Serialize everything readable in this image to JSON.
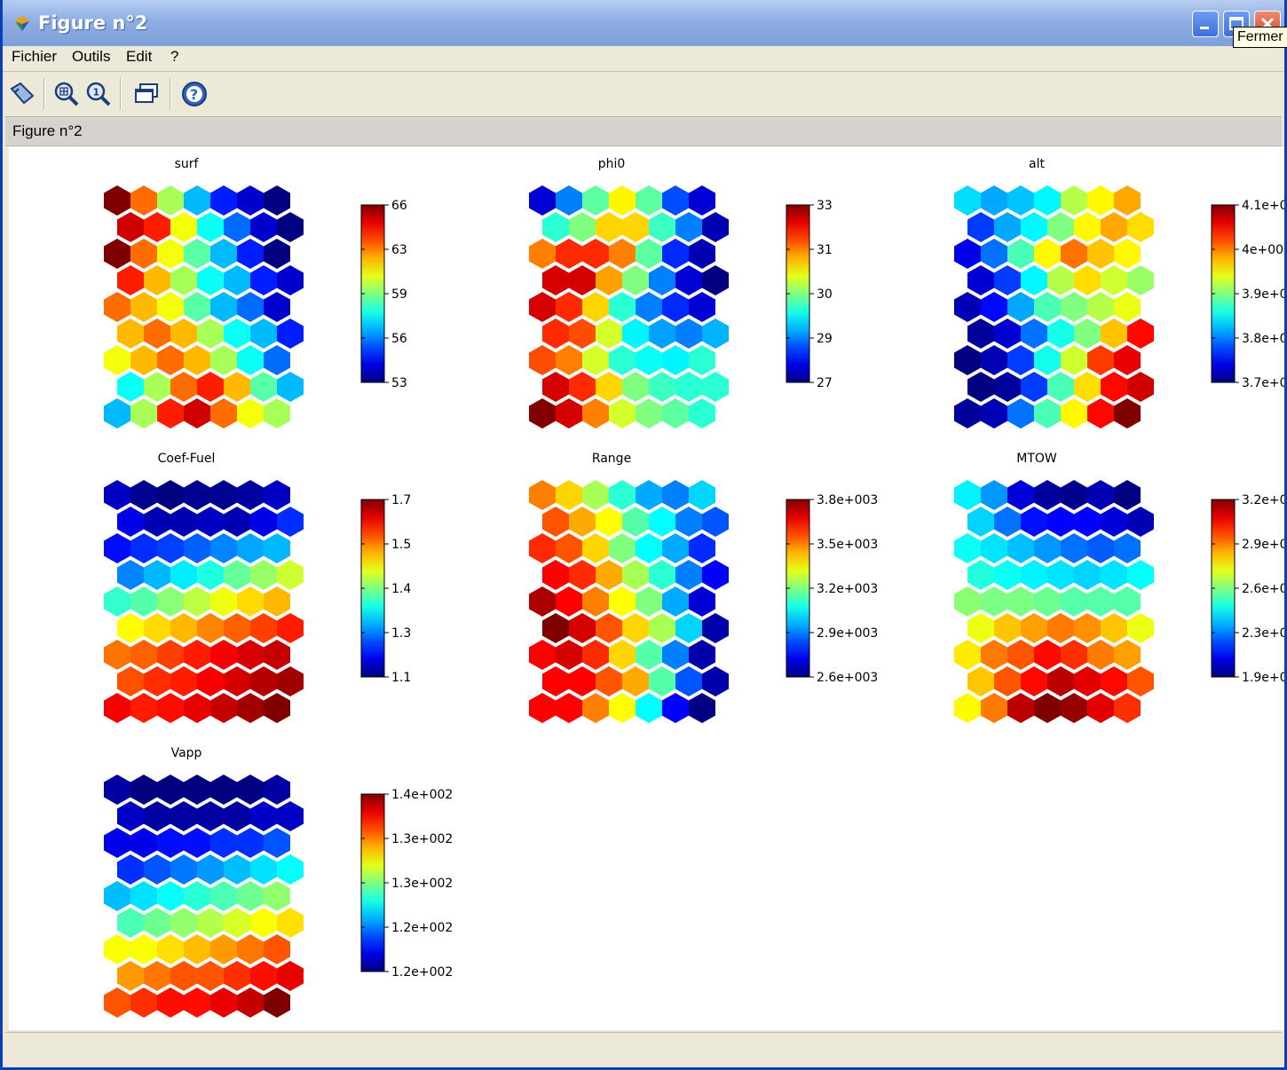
{
  "window": {
    "title": "Figure n°2",
    "tooltip": "Fermer"
  },
  "menu": [
    "Fichier",
    "Outils",
    "Edit",
    "?"
  ],
  "toolbar": {
    "icons": [
      "pointer-icon",
      "zoom-in-icon",
      "zoom-reset-icon",
      "window-icon",
      "help-icon"
    ]
  },
  "figure_label": "Figure n°2",
  "chart_data": [
    {
      "type": "heatmap",
      "title": "surf",
      "ticks": [
        "66",
        "63",
        "59",
        "56",
        "53"
      ],
      "values": [
        [
          66,
          63,
          60,
          57,
          55,
          54,
          53
        ],
        [
          65,
          64,
          61,
          58,
          56,
          54,
          53
        ],
        [
          66,
          63,
          61,
          59,
          57,
          55,
          53
        ],
        [
          64,
          62,
          60,
          58,
          57,
          55,
          54
        ],
        [
          63,
          62,
          61,
          59,
          57,
          56,
          54
        ],
        [
          62,
          63,
          62,
          60,
          58,
          57,
          55
        ],
        [
          61,
          62,
          63,
          62,
          60,
          58,
          56
        ],
        [
          58,
          60,
          63,
          64,
          62,
          59,
          57
        ],
        [
          57,
          60,
          64,
          65,
          63,
          61,
          60
        ]
      ]
    },
    {
      "type": "heatmap",
      "title": "phi0",
      "ticks": [
        "33",
        "31",
        "30",
        "29",
        "27"
      ],
      "values": [
        [
          27.5,
          28.5,
          29.8,
          30.8,
          29.8,
          28.2,
          27.5
        ],
        [
          29.5,
          30.0,
          31.0,
          31.0,
          29.6,
          28.5,
          27.3
        ],
        [
          31.5,
          32.0,
          32.0,
          31.5,
          29.8,
          28.0,
          27.3
        ],
        [
          32.5,
          32.5,
          31.3,
          30.0,
          28.5,
          27.5,
          27.0
        ],
        [
          32.5,
          32.0,
          31.0,
          29.5,
          28.5,
          28.0,
          27.5
        ],
        [
          32.0,
          31.8,
          30.5,
          29.2,
          28.7,
          28.5,
          28.8
        ],
        [
          31.8,
          31.5,
          30.5,
          29.5,
          29.3,
          29.2,
          29.5
        ],
        [
          32.5,
          32.0,
          31.0,
          30.0,
          29.6,
          29.5,
          29.5
        ],
        [
          33.0,
          32.5,
          31.5,
          30.5,
          30.0,
          29.8,
          29.5
        ]
      ]
    },
    {
      "type": "heatmap",
      "title": "alt",
      "ticks": [
        "4.1e+0",
        "4e+00",
        "3.9e+0",
        "3.8e+0",
        "3.7e+0"
      ],
      "values": [
        [
          3.84,
          3.82,
          3.83,
          3.85,
          3.92,
          3.95,
          3.98
        ],
        [
          3.78,
          3.82,
          3.85,
          3.9,
          3.95,
          3.98,
          3.96
        ],
        [
          3.75,
          3.8,
          3.88,
          3.95,
          4.0,
          3.97,
          3.95
        ],
        [
          3.74,
          3.78,
          3.85,
          3.92,
          3.96,
          3.93,
          3.91
        ],
        [
          3.73,
          3.76,
          3.82,
          3.88,
          3.9,
          3.92,
          3.94
        ],
        [
          3.72,
          3.74,
          3.8,
          3.86,
          3.9,
          3.97,
          4.04
        ],
        [
          3.71,
          3.73,
          3.78,
          3.86,
          3.93,
          4.02,
          4.05
        ],
        [
          3.71,
          3.72,
          3.78,
          3.88,
          3.96,
          4.04,
          4.06
        ],
        [
          3.72,
          3.73,
          3.8,
          3.88,
          3.95,
          4.04,
          4.09
        ]
      ]
    },
    {
      "type": "heatmap",
      "title": "Coef-Fuel",
      "ticks": [
        "1.7",
        "1.5",
        "1.4",
        "1.3",
        "1.1"
      ],
      "values": [
        [
          1.17,
          1.14,
          1.13,
          1.14,
          1.14,
          1.15,
          1.17
        ],
        [
          1.19,
          1.16,
          1.16,
          1.17,
          1.16,
          1.19,
          1.23
        ],
        [
          1.21,
          1.23,
          1.24,
          1.26,
          1.28,
          1.3,
          1.31
        ],
        [
          1.28,
          1.31,
          1.34,
          1.37,
          1.41,
          1.44,
          1.47
        ],
        [
          1.38,
          1.4,
          1.43,
          1.46,
          1.49,
          1.52,
          1.54
        ],
        [
          1.5,
          1.52,
          1.54,
          1.57,
          1.59,
          1.61,
          1.63
        ],
        [
          1.58,
          1.59,
          1.61,
          1.63,
          1.65,
          1.67,
          1.68
        ],
        [
          1.6,
          1.62,
          1.63,
          1.65,
          1.67,
          1.69,
          1.7
        ],
        [
          1.65,
          1.63,
          1.64,
          1.66,
          1.68,
          1.7,
          1.72
        ]
      ]
    },
    {
      "type": "heatmap",
      "title": "Range",
      "ticks": [
        "3.8e+003",
        "3.5e+003",
        "3.2e+003",
        "2.9e+003",
        "2.6e+003"
      ],
      "values": [
        [
          3550,
          3450,
          3300,
          3150,
          3000,
          2950,
          3050
        ],
        [
          3600,
          3500,
          3400,
          3200,
          3100,
          2950,
          2900
        ],
        [
          3650,
          3600,
          3450,
          3250,
          3100,
          3000,
          2850
        ],
        [
          3700,
          3650,
          3500,
          3300,
          3150,
          2950,
          2800
        ],
        [
          3800,
          3700,
          3550,
          3400,
          3250,
          3000,
          2750
        ],
        [
          3850,
          3750,
          3600,
          3450,
          3300,
          3050,
          2700
        ],
        [
          3700,
          3750,
          3650,
          3450,
          3200,
          2950,
          2700
        ],
        [
          3700,
          3700,
          3600,
          3500,
          3200,
          2900,
          2700
        ],
        [
          3700,
          3700,
          3550,
          3400,
          3100,
          2800,
          2650
        ]
      ]
    },
    {
      "type": "heatmap",
      "title": "MTOW",
      "ticks": [
        "3.2e+0",
        "2.9e+0",
        "2.6e+0",
        "2.3e+0",
        "1.9e+0"
      ],
      "values": [
        [
          2.42,
          2.3,
          2.05,
          1.97,
          1.95,
          2.0,
          1.93
        ],
        [
          2.38,
          2.25,
          2.12,
          2.1,
          2.1,
          2.05,
          2.0
        ],
        [
          2.45,
          2.4,
          2.35,
          2.3,
          2.25,
          2.22,
          2.25
        ],
        [
          2.48,
          2.45,
          2.42,
          2.4,
          2.38,
          2.4,
          2.44
        ],
        [
          2.62,
          2.6,
          2.6,
          2.58,
          2.55,
          2.55,
          2.55
        ],
        [
          2.75,
          2.85,
          2.9,
          2.95,
          2.92,
          2.85,
          2.75
        ],
        [
          2.8,
          2.95,
          3.0,
          3.1,
          3.05,
          2.95,
          2.9
        ],
        [
          2.85,
          3.0,
          3.1,
          3.2,
          3.15,
          3.1,
          3.0
        ],
        [
          2.78,
          2.95,
          3.2,
          3.28,
          3.25,
          3.15,
          3.05
        ]
      ]
    },
    {
      "type": "heatmap",
      "title": "Vapp",
      "ticks": [
        "1.4e+002",
        "1.3e+002",
        "1.3e+002",
        "1.2e+002",
        "1.2e+002"
      ],
      "values": [
        [
          117,
          116,
          116,
          116,
          116,
          116,
          117
        ],
        [
          118,
          117,
          117,
          117,
          117,
          118,
          118
        ],
        [
          119,
          119,
          120,
          120,
          121,
          121,
          122
        ],
        [
          121,
          122,
          123,
          124,
          125,
          126,
          127
        ],
        [
          125,
          126,
          127,
          128,
          129,
          130,
          131
        ],
        [
          129,
          130,
          131,
          132,
          133,
          134,
          135
        ],
        [
          134,
          134,
          135,
          136,
          137,
          138,
          139
        ],
        [
          137,
          138,
          139,
          139,
          140,
          141,
          142
        ],
        [
          139,
          140,
          141,
          141,
          142,
          143,
          145
        ]
      ]
    }
  ]
}
